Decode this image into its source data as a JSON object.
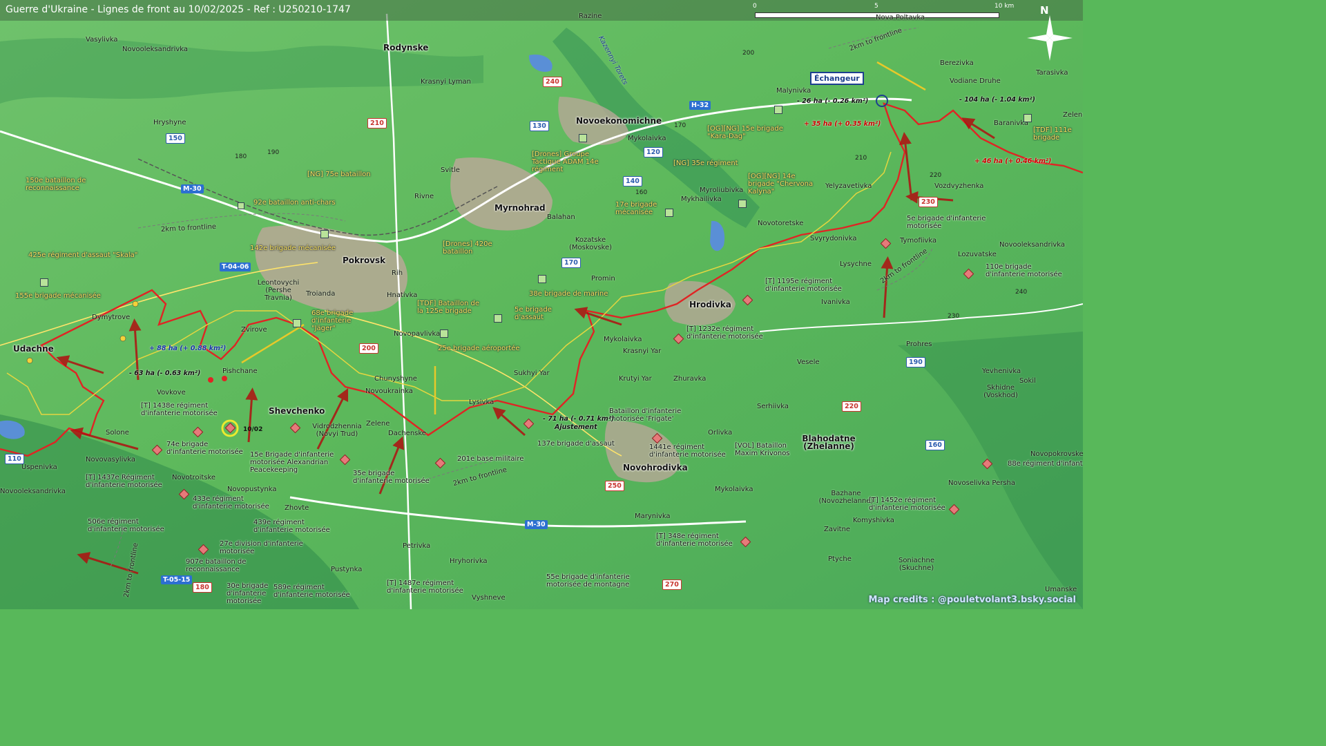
{
  "title": "Guerre d'Ukraine - Lignes de front au 10/02/2025 - Ref : U250210-1747",
  "scale": {
    "ticks": [
      "0",
      "5",
      "10 km"
    ]
  },
  "north": "N",
  "credits": "Map credits : @pouletvolant3.bsky.social",
  "callout": "Échangeur",
  "date_marker": "10/02",
  "towns": [
    "Pokrovsk",
    "Myrnohrad",
    "Hrodivka",
    "Novohrodivka",
    "Udachne",
    "Shevchenko",
    "Blahodatne (Zhelanne)",
    "Rodynske",
    "Novoekonomichne"
  ],
  "villages": [
    "Vasylivka",
    "Novooleksandrivka",
    "Razine",
    "Nova Poltavka",
    "Krasnyi Lyman",
    "Hryshyne",
    "Svitle",
    "Rivne",
    "Balahan",
    "Kozatske (Moskovske)",
    "Promin",
    "Rih",
    "Hnativka",
    "Troianda",
    "Leontovychi (Pershe Travnia)",
    "Zvirove",
    "Dymytrove",
    "Pishchane",
    "Vovkove",
    "Solone",
    "Novovasylivka",
    "Uspenivka",
    "Novotroitske",
    "Novopustynka",
    "Zhovte",
    "Novopavlivka",
    "Sukhyi Yar",
    "Chunyshyne",
    "Novoukrainka",
    "Lysivka",
    "Zelene",
    "Dachenske",
    "Vidrodzhennia (Novyi Trud)",
    "Mykolaivka",
    "Krasnyi Yar",
    "Krutyi Yar",
    "Zhuravka",
    "Orlivka",
    "Serhiivka",
    "Veselе",
    "Prohres",
    "Yevhenivka",
    "Sokil",
    "Skhidne (Voskhod)",
    "Novopokrovske",
    "Novoselivka Persha",
    "Bazhane (Novozhelanne)",
    "Komyshivka",
    "Zavitne",
    "Ptyche",
    "Soniachne (Skuchne)",
    "Umanske",
    "Malynivka",
    "Berezivka",
    "Tarasivka",
    "Vodiane Druhe",
    "Baranivka",
    "Zelene",
    "Mykolaivka",
    "Myroliubivka",
    "Mykhailivka",
    "Yelyzavetivka",
    "Vozdvyzhenka",
    "Novotoretske",
    "Svyrydonivka",
    "Tymofiivka",
    "Lysychne",
    "Lozuvatske",
    "Novooleksandrivka",
    "Ivanivka",
    "Marynivka",
    "Petrivka",
    "Pustynka",
    "Hryhorivka",
    "Vyshneve",
    "Novooleksandrivka",
    "Mykolaivka"
  ],
  "units": [
    "150e bataillon de reconnaissance",
    "[NG] 75e bataillon",
    "92e bataillon anti-chars",
    "142e brigade mécanisée",
    "425e régiment d'assaut \"Skala\"",
    "155e brigade mécanisée",
    "[Drones] Groupe Tactique ADAM 14e régiment",
    "[Drones] 420e bataillon",
    "[TDF] Bataillon de la 125e brigade",
    "5e brigade d'assaut",
    "68e brigade d'infanterie \"Jäger\"",
    "38e brigade de marine",
    "25e brigade aéroportée",
    "17e brigade mécanisée",
    "[NG] 35e régiment",
    "[OG][NG] 15e brigade \"Kara-Dag\"",
    "[OG][NG] 14e brigade \"Chervona Kalyna\"",
    "[TDF] 111e brigade",
    "5e brigade d'infanterie motorisée",
    "110e brigade d'infanterie motorisée",
    "[T] 1195e régiment d'infanterie motorisée",
    "[T] 1232e régiment d'infanterie motorisée",
    "[T] 1438e régiment d'infanterie motorisée",
    "74e brigade d'infanterie motorisée",
    "15e Brigade d'infanterie motorisée Alexandrian Peacekeeping",
    "35e brigade d'infanterie motorisée",
    "201e base militaire",
    "137e brigade d'assaut",
    "Bataillon d'infanterie motorisée 'Frigate'",
    "1441e régiment d'infanterie motorisée",
    "[VOL] Bataillon Maxim Krivonos",
    "[T] 1437e Régiment d'infanterie motorisée",
    "433e régiment d'infanterie motorisée",
    "439e régiment d'infanterie motorisée",
    "506e régiment d'infanterie motorisée",
    "27e division d'infanterie motorisée",
    "907e bataillon de reconnaissance",
    "30e brigade d'infanterie motorisée",
    "589e régiment d'infanterie motorisée",
    "[T] 1487e régiment d'infanterie motorisée",
    "55e brigade d'infanterie motorisée de montagne",
    "[T] 348e régiment d'infanterie motorisée",
    "[T] 1452e régiment d'infanterie motorisée",
    "88e régiment d'infant"
  ],
  "area_changes": [
    "- 26 ha (- 0.26 km²)",
    "+ 35 ha (+ 0.35 km²)",
    "- 104 ha (- 1.04 km²)",
    "+ 46 ha (+ 0.46 km²)",
    "+ 88 ha (+ 0.88 km²)",
    "- 63 ha (- 0.63 km²)",
    "- 71 ha (- 0.71 km²)",
    "Ajustement"
  ],
  "roads": [
    "M-30",
    "H-32",
    "T-04-06",
    "T-05-15",
    "M-30",
    "130",
    "150",
    "240",
    "210",
    "140",
    "120",
    "170",
    "230",
    "250",
    "220",
    "160",
    "110",
    "190",
    "200",
    "270",
    "180"
  ],
  "elevations": [
    "200",
    "180",
    "190",
    "170",
    "160",
    "210",
    "220",
    "230",
    "240",
    "250"
  ],
  "frontline_labels": [
    "2km to frontline",
    "2km to frontline",
    "2km to frontline",
    "2km to frontline",
    "2km to frontline"
  ],
  "river": "Kazennyi Torets"
}
